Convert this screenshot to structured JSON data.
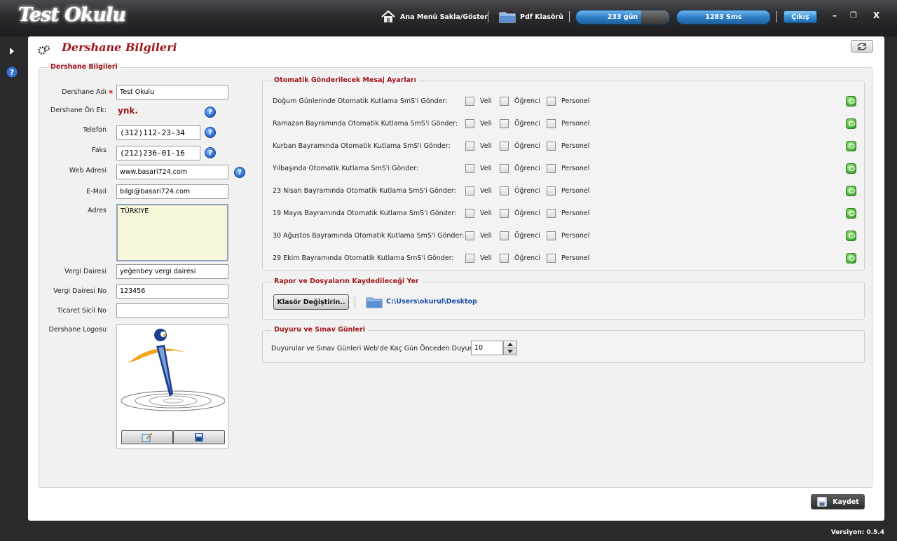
{
  "app": {
    "title": "Test Okulu"
  },
  "toolbar": {
    "menu_toggle_label": "Ana Menü Sakla/Göster",
    "pdf_folder_label": "Pdf Klasörü",
    "days_label": "233 gün",
    "sms_label": "1283 Sms",
    "exit_label": "Çıkış",
    "minimize": "–",
    "restore": "❐",
    "close": "X"
  },
  "panel": {
    "title": "Dershane Bilgileri"
  },
  "info": {
    "group_label": "Dershane Bilgileri",
    "name_label": "Dershane Adı",
    "name_value": "Test Okulu",
    "prefix_label": "Dershane Ön Ek:",
    "prefix_value": "ynk.",
    "phone_label": "Telefon",
    "phone_value": "(312)112-23-34",
    "fax_label": "Faks",
    "fax_value": "(212)236-01-16",
    "web_label": "Web Adresi",
    "web_value": "www.basari724.com",
    "email_label": "E-Mail",
    "email_value": "bilgi@basari724.com",
    "address_label": "Adres",
    "address_value": "TÜRKIYE",
    "tax_office_label": "Vergi Dairesi",
    "tax_office_value": "yeğenbey vergi dairesi",
    "tax_no_label": "Vergi Dairesi No",
    "tax_no_value": "123456",
    "trade_reg_label": "Ticaret Sicil No",
    "trade_reg_value": "",
    "logo_label": "Dershane Logosu"
  },
  "sms_settings": {
    "group_label": "Otomatik Gönderilecek Mesaj Ayarları",
    "option_labels": [
      "Veli",
      "Öğrenci",
      "Personel"
    ],
    "rows": [
      {
        "label": "Doğum Günlerinde Otomatik Kutlama SmS'i Gönder:"
      },
      {
        "label": "Ramazan Bayramında Otomatik Kutlama SmS'i Gönder:"
      },
      {
        "label": "Kurban Bayramında Otomatik Kutlama SmS'i Gönder:"
      },
      {
        "label": "Yılbaşında Otomatik Kutlama SmS'i Gönder:"
      },
      {
        "label": "23 Nisan Bayramında Otomatik Kutlama SmS'i Gönder:"
      },
      {
        "label": "19 Mayıs Bayramında Otomatik Kutlama SmS'i Gönder:"
      },
      {
        "label": "30 Ağustos Bayramında Otomatik Kutlama SmS'i Gönder:"
      },
      {
        "label": "29 Ekim Bayramında Otomatik Kutlama SmS'i Gönder:"
      }
    ]
  },
  "report": {
    "group_label": "Rapor ve Dosyaların Kaydedileceği Yer",
    "button_label": "Klasör Değiştirin..",
    "path": "C:\\Users\\okurul\\Desktop"
  },
  "announce": {
    "group_label": "Duyuru ve Sınav Günleri",
    "label": "Duyurular ve Sınav Günleri Web'de Kaç Gün Önceden Duyurulsun:",
    "value": "10"
  },
  "footer": {
    "save_label": "Kaydet",
    "version": "Versiyon: 0.5.4"
  },
  "colors": {
    "accent": "#a0161b",
    "link": "#1d4fa8",
    "address_bg": "#f7f6d9"
  }
}
